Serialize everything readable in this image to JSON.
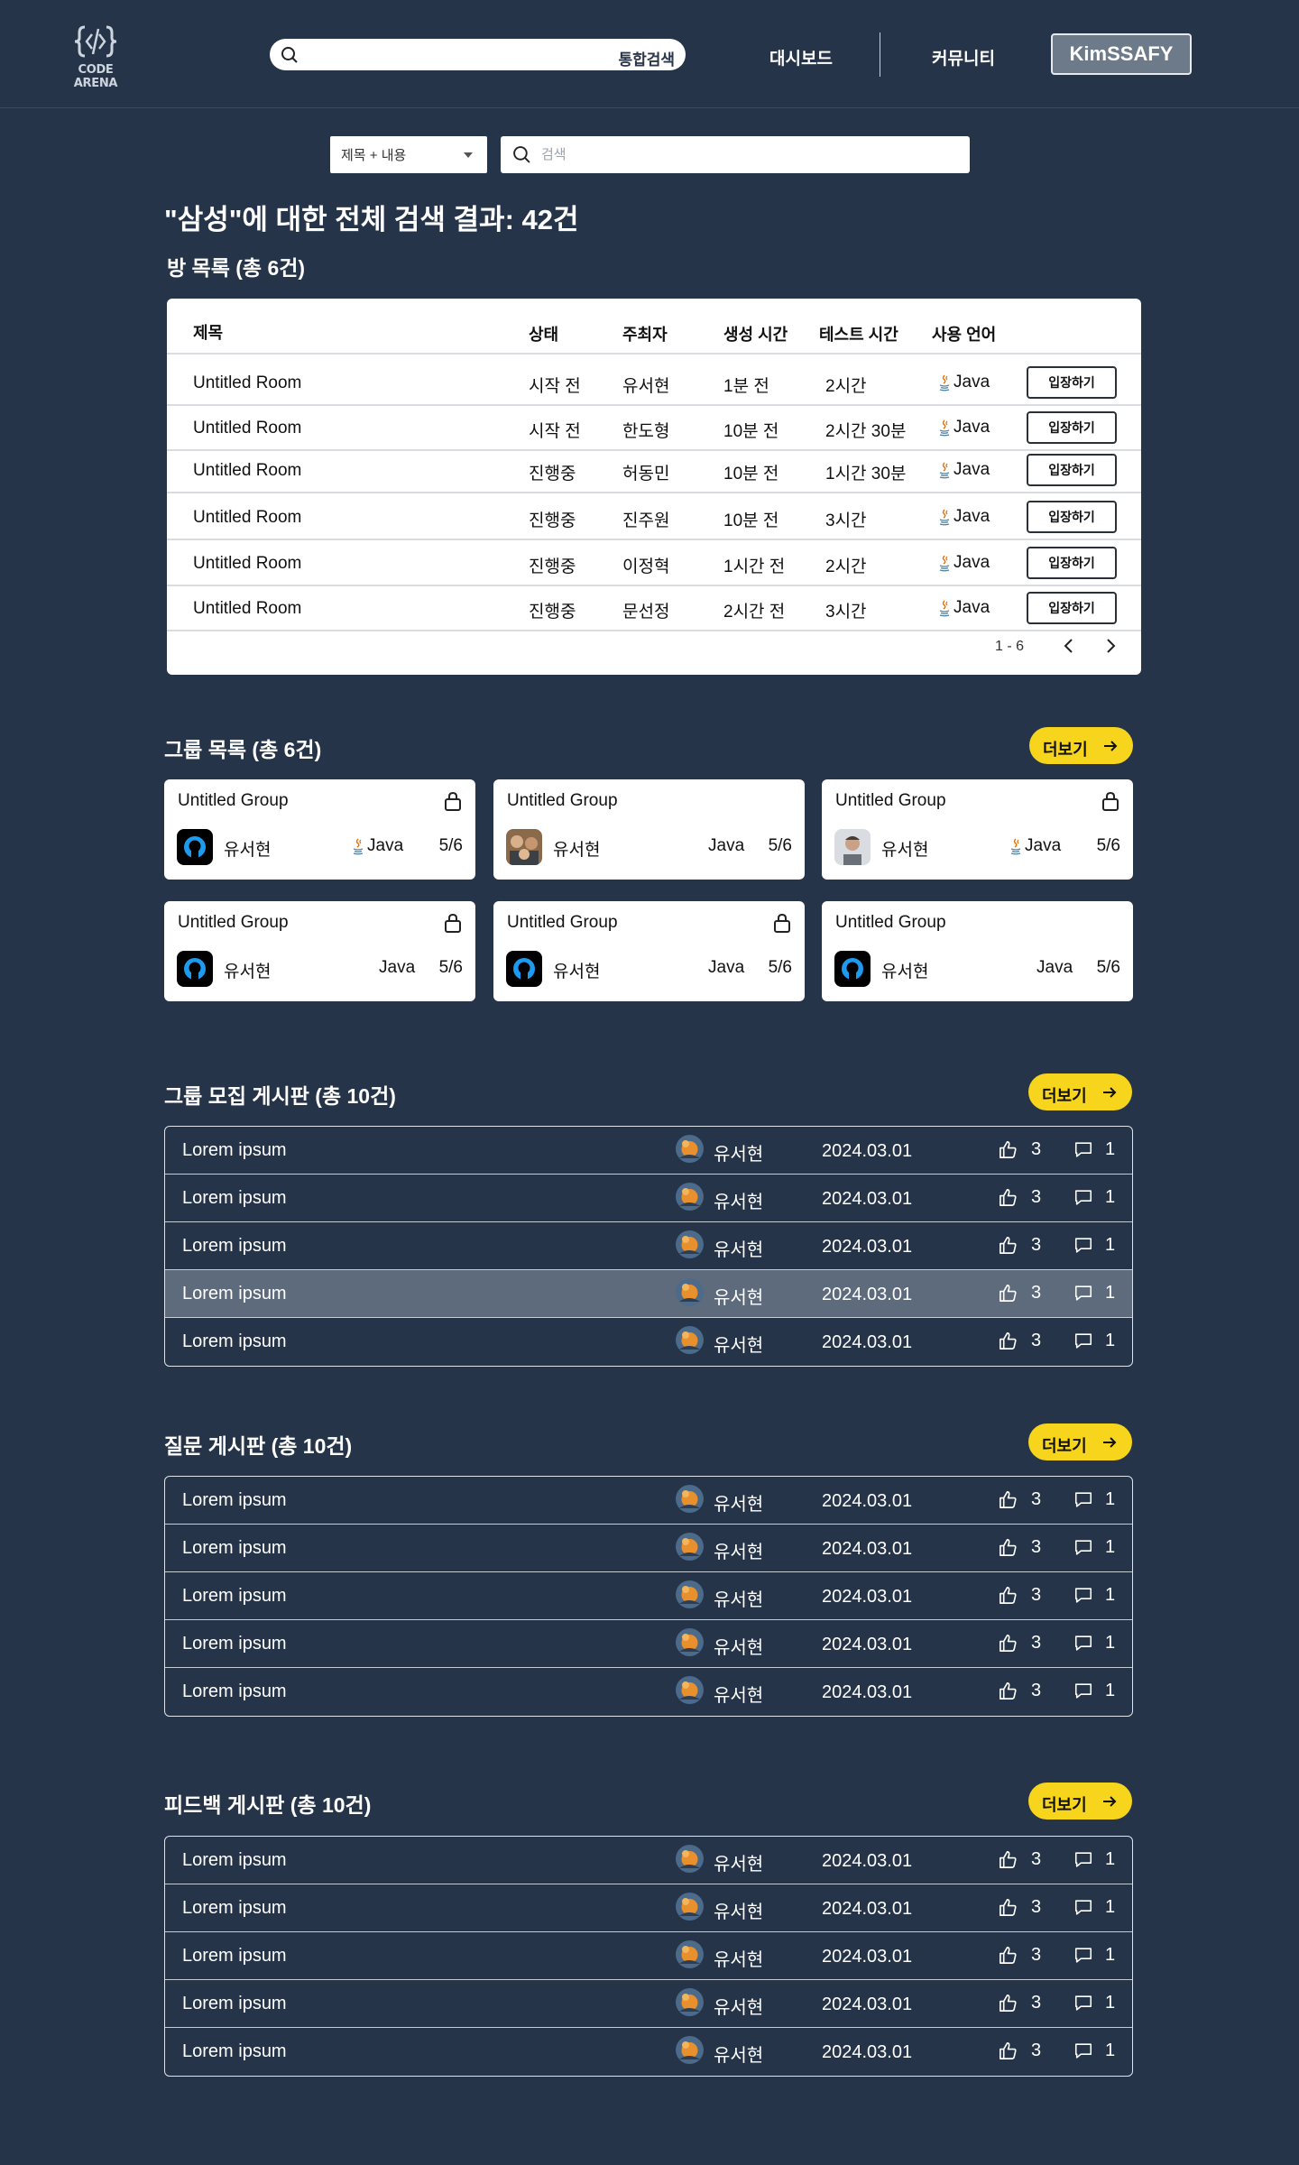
{
  "header": {
    "logo_text": "CODE ARENA",
    "search_label": "통합검색",
    "nav": [
      "대시보드",
      "커뮤니티"
    ],
    "user_button": "KimSSAFY"
  },
  "search": {
    "filter_selected": "제목 + 내용",
    "placeholder": "검색"
  },
  "result_title": "\"삼성\"에 대한 전체 검색 결과: 42건",
  "rooms": {
    "section_title": "방 목록 (총 6건)",
    "columns": [
      "제목",
      "상태",
      "주최자",
      "생성 시간",
      "테스트 시간",
      "사용 언어"
    ],
    "enter_label": "입장하기",
    "rows": [
      {
        "title": "Untitled Room",
        "state": "시작 전",
        "host": "유서현",
        "created": "1분 전",
        "test": "2시간",
        "lang": "Java"
      },
      {
        "title": "Untitled Room",
        "state": "시작 전",
        "host": "한도형",
        "created": "10분 전",
        "test": "2시간 30분",
        "lang": "Java"
      },
      {
        "title": "Untitled Room",
        "state": "진행중",
        "host": "허동민",
        "created": "10분 전",
        "test": "1시간 30분",
        "lang": "Java"
      },
      {
        "title": "Untitled Room",
        "state": "진행중",
        "host": "진주원",
        "created": "10분 전",
        "test": "3시간",
        "lang": "Java"
      },
      {
        "title": "Untitled Room",
        "state": "진행중",
        "host": "이정혁",
        "created": "1시간 전",
        "test": "2시간",
        "lang": "Java"
      },
      {
        "title": "Untitled Room",
        "state": "진행중",
        "host": "문선정",
        "created": "2시간 전",
        "test": "3시간",
        "lang": "Java"
      }
    ],
    "pager": "1 - 6"
  },
  "groups": {
    "section_title": "그룹 목록 (총 6건)",
    "more_label": "더보기",
    "cards": [
      {
        "name": "Untitled Group",
        "owner": "유서현",
        "lang": "Java",
        "count": "5/6",
        "locked": true,
        "avatar": "github",
        "java_icon": true
      },
      {
        "name": "Untitled Group",
        "owner": "유서현",
        "lang": "Java",
        "count": "5/6",
        "locked": false,
        "avatar": "photo-group",
        "java_icon": false
      },
      {
        "name": "Untitled Group",
        "owner": "유서현",
        "lang": "Java",
        "count": "5/6",
        "locked": true,
        "avatar": "photo-person",
        "java_icon": true
      },
      {
        "name": "Untitled Group",
        "owner": "유서현",
        "lang": "Java",
        "count": "5/6",
        "locked": true,
        "avatar": "github",
        "java_icon": false
      },
      {
        "name": "Untitled Group",
        "owner": "유서현",
        "lang": "Java",
        "count": "5/6",
        "locked": true,
        "avatar": "github",
        "java_icon": false
      },
      {
        "name": "Untitled Group",
        "owner": "유서현",
        "lang": "Java",
        "count": "5/6",
        "locked": false,
        "avatar": "github",
        "java_icon": false
      }
    ]
  },
  "boards": [
    {
      "title": "그룹 모집 게시판 (총 10건)",
      "more_label": "더보기",
      "rows": [
        {
          "title": "Lorem ipsum",
          "author": "유서현",
          "date": "2024.03.01",
          "likes": "3",
          "comments": "1"
        },
        {
          "title": "Lorem ipsum",
          "author": "유서현",
          "date": "2024.03.01",
          "likes": "3",
          "comments": "1"
        },
        {
          "title": "Lorem ipsum",
          "author": "유서현",
          "date": "2024.03.01",
          "likes": "3",
          "comments": "1"
        },
        {
          "title": "Lorem ipsum",
          "author": "유서현",
          "date": "2024.03.01",
          "likes": "3",
          "comments": "1",
          "highlighted": true
        },
        {
          "title": "Lorem ipsum",
          "author": "유서현",
          "date": "2024.03.01",
          "likes": "3",
          "comments": "1"
        }
      ]
    },
    {
      "title": "질문 게시판 (총 10건)",
      "more_label": "더보기",
      "rows": [
        {
          "title": "Lorem ipsum",
          "author": "유서현",
          "date": "2024.03.01",
          "likes": "3",
          "comments": "1"
        },
        {
          "title": "Lorem ipsum",
          "author": "유서현",
          "date": "2024.03.01",
          "likes": "3",
          "comments": "1"
        },
        {
          "title": "Lorem ipsum",
          "author": "유서현",
          "date": "2024.03.01",
          "likes": "3",
          "comments": "1"
        },
        {
          "title": "Lorem ipsum",
          "author": "유서현",
          "date": "2024.03.01",
          "likes": "3",
          "comments": "1"
        },
        {
          "title": "Lorem ipsum",
          "author": "유서현",
          "date": "2024.03.01",
          "likes": "3",
          "comments": "1"
        }
      ]
    },
    {
      "title": "피드백 게시판 (총 10건)",
      "more_label": "더보기",
      "rows": [
        {
          "title": "Lorem ipsum",
          "author": "유서현",
          "date": "2024.03.01",
          "likes": "3",
          "comments": "1"
        },
        {
          "title": "Lorem ipsum",
          "author": "유서현",
          "date": "2024.03.01",
          "likes": "3",
          "comments": "1"
        },
        {
          "title": "Lorem ipsum",
          "author": "유서현",
          "date": "2024.03.01",
          "likes": "3",
          "comments": "1"
        },
        {
          "title": "Lorem ipsum",
          "author": "유서현",
          "date": "2024.03.01",
          "likes": "3",
          "comments": "1"
        },
        {
          "title": "Lorem ipsum",
          "author": "유서현",
          "date": "2024.03.01",
          "likes": "3",
          "comments": "1"
        }
      ]
    }
  ],
  "colors": {
    "background": "#253449",
    "accent_yellow": "#f7d51d",
    "card": "#ffffff",
    "highlight_row": "#5e6b7c"
  }
}
